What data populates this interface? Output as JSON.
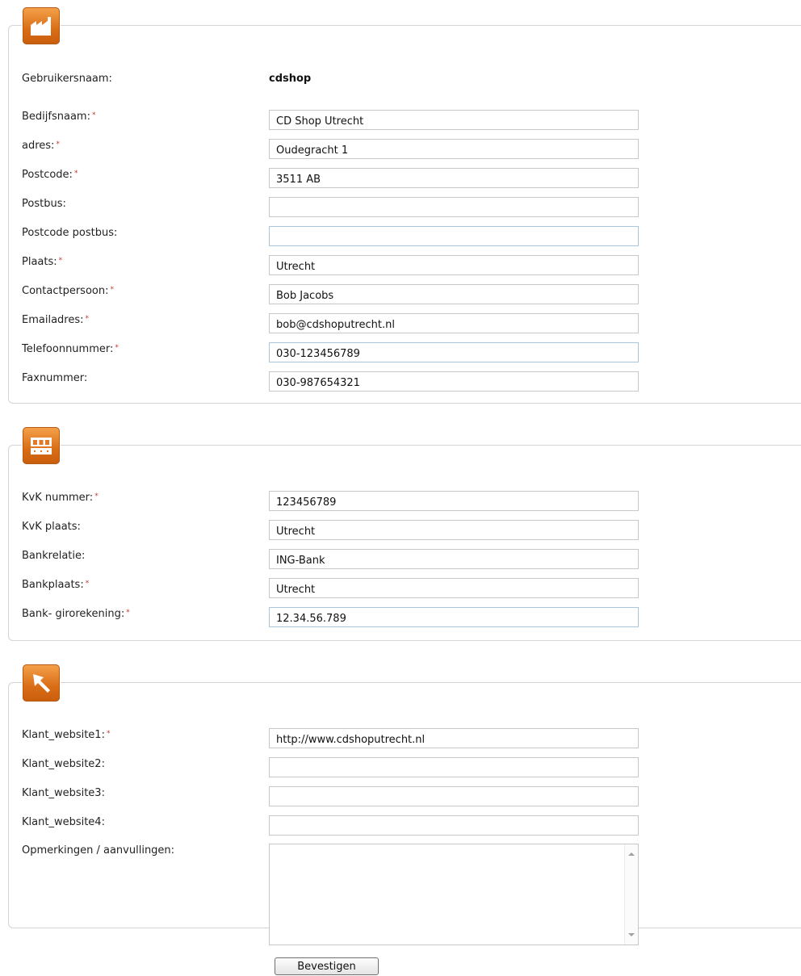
{
  "company": {
    "icon": "factory-icon",
    "username_label": "Gebruikersnaam:",
    "username_value": "cdshop",
    "fields": [
      {
        "label": "Bedijfsnaam:",
        "value": "CD Shop Utrecht",
        "required": true
      },
      {
        "label": "adres:",
        "value": "Oudegracht 1",
        "required": true
      },
      {
        "label": "Postcode:",
        "value": "3511 AB",
        "required": true
      },
      {
        "label": "Postbus:",
        "value": "",
        "required": false
      },
      {
        "label": "Postcode postbus:",
        "value": "",
        "required": false
      },
      {
        "label": "Plaats:",
        "value": "Utrecht",
        "required": true
      },
      {
        "label": "Contactpersoon:",
        "value": "Bob Jacobs",
        "required": true
      },
      {
        "label": "Emailadres:",
        "value": "bob@cdshoputrecht.nl",
        "required": true
      },
      {
        "label": "Telefoonnummer:",
        "value": "030-123456789",
        "required": true
      },
      {
        "label": "Faxnummer:",
        "value": "030-987654321",
        "required": false
      }
    ]
  },
  "bank": {
    "icon": "building-icon",
    "fields": [
      {
        "label": "KvK nummer:",
        "value": "123456789",
        "required": true
      },
      {
        "label": "KvK plaats:",
        "value": "Utrecht",
        "required": false
      },
      {
        "label": "Bankrelatie:",
        "value": "ING-Bank",
        "required": false
      },
      {
        "label": "Bankplaats:",
        "value": "Utrecht",
        "required": true
      },
      {
        "label": "Bank- girorekening:",
        "value": "12.34.56.789",
        "required": true
      }
    ]
  },
  "websites": {
    "icon": "cursor-arrow-icon",
    "fields": [
      {
        "label": "Klant_website1:",
        "value": "http://www.cdshoputrecht.nl",
        "required": true
      },
      {
        "label": "Klant_website2:",
        "value": "",
        "required": false
      },
      {
        "label": "Klant_website3:",
        "value": "",
        "required": false
      },
      {
        "label": "Klant_website4:",
        "value": "",
        "required": false
      }
    ],
    "remarks_label": "Opmerkingen / aanvullingen:",
    "remarks_value": ""
  },
  "required_marker": "*",
  "submit_label": "Bevestigen",
  "colors": {
    "accent_orange": "#d96d17",
    "required": "#c0392b",
    "border": "#d4d4d4"
  }
}
